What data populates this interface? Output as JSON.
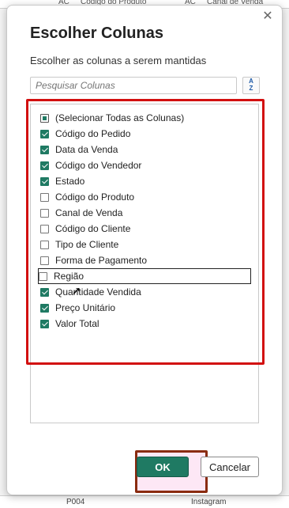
{
  "background": {
    "header_cols": [
      "Código do Produto",
      "Canal de Venda"
    ],
    "header_icon": "A͈C",
    "footer_cells": [
      "P004",
      "Instagram"
    ]
  },
  "dialog": {
    "title": "Escolher Colunas",
    "subtitle": "Escolher as colunas a serem mantidas",
    "close_icon": "✕",
    "search_placeholder": "Pesquisar Colunas",
    "sort_icon_top": "A",
    "sort_icon_bottom": "Z",
    "select_all": "(Selecionar Todas as Colunas)",
    "columns": [
      {
        "label": "Código do Pedido",
        "checked": true
      },
      {
        "label": "Data da Venda",
        "checked": true
      },
      {
        "label": "Código do Vendedor",
        "checked": true
      },
      {
        "label": "Estado",
        "checked": true
      },
      {
        "label": "Código do Produto",
        "checked": false
      },
      {
        "label": "Canal de Venda",
        "checked": false
      },
      {
        "label": "Código do Cliente",
        "checked": false
      },
      {
        "label": "Tipo de Cliente",
        "checked": false
      },
      {
        "label": "Forma de Pagamento",
        "checked": false
      },
      {
        "label": "Região",
        "checked": false
      },
      {
        "label": "Quantidade Vendida",
        "checked": true
      },
      {
        "label": "Preço Unitário",
        "checked": true
      },
      {
        "label": "Valor Total",
        "checked": true
      }
    ],
    "ok_label": "OK",
    "cancel_label": "Cancelar",
    "accent_color": "#1f7a63",
    "highlight_color": "#d20f0f"
  }
}
